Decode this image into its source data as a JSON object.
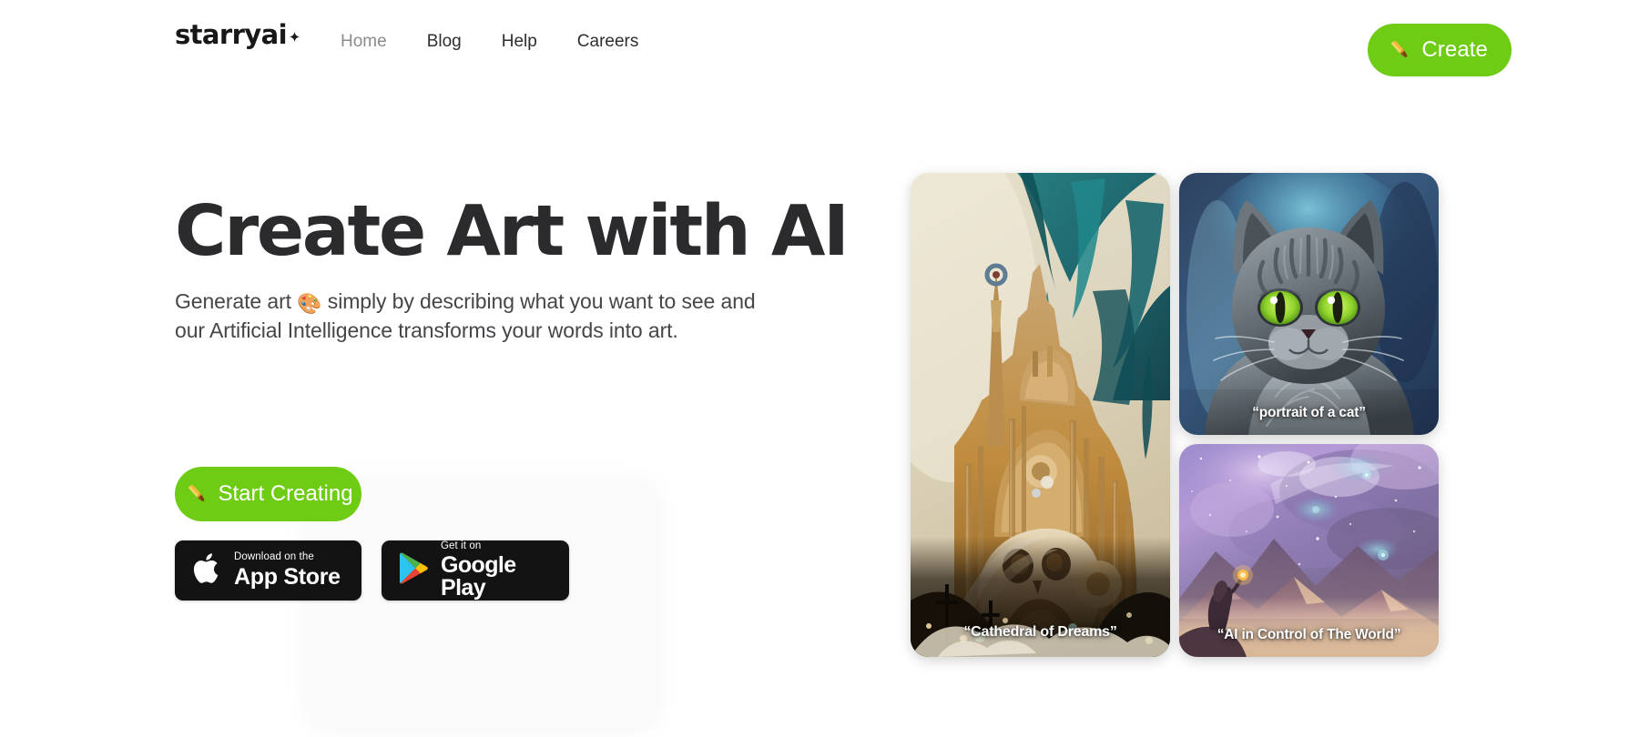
{
  "header": {
    "logo_text": "starryai",
    "logo_star_icon": "sparkle-icon",
    "nav": [
      {
        "label": "Home",
        "active": true
      },
      {
        "label": "Blog",
        "active": false
      },
      {
        "label": "Help",
        "active": false
      },
      {
        "label": "Careers",
        "active": false
      }
    ],
    "create_button": {
      "label": "Create",
      "icon": "paintbrush-icon",
      "color": "#6ECC14"
    }
  },
  "hero": {
    "title": "Create Art with AI",
    "subtitle_part1": "Generate art ",
    "subtitle_emoji": "🎨",
    "subtitle_part2": " simply by describing what you want to see and our Artificial Intelligence transforms your words into art.",
    "cta": {
      "label": "Start Creating",
      "icon": "paintbrush-icon",
      "color": "#6ECC14"
    },
    "store_badges": [
      {
        "icon": "apple-logo-icon",
        "top_line": "Download on the",
        "main_line": "App Store"
      },
      {
        "icon": "google-play-icon",
        "top_line": "Get it on",
        "main_line": "Google Play"
      }
    ]
  },
  "gallery": {
    "items": [
      {
        "name": "cathedral-of-dreams",
        "caption": "“Cathedral of Dreams”",
        "palette": [
          "#ddd6c2",
          "#1d7a7e",
          "#c98a33",
          "#2a2016"
        ]
      },
      {
        "name": "portrait-of-a-cat",
        "caption": "“portrait of a cat”",
        "palette": [
          "#2e4a6e",
          "#79c6d8",
          "#8d9299",
          "#8ede3a"
        ]
      },
      {
        "name": "ai-in-control-of-the-world",
        "caption": "“AI in Control of The World”",
        "palette": [
          "#8a7bbd",
          "#c8a8d8",
          "#6b5570",
          "#e8c49a"
        ]
      }
    ]
  },
  "colors": {
    "accent_green": "#6ECC14",
    "text_dark": "#2b2b2e",
    "text_body": "#46464a",
    "nav_inactive": "#8b8b90",
    "badge_black": "#131313",
    "page_bg": "#ffffff"
  }
}
